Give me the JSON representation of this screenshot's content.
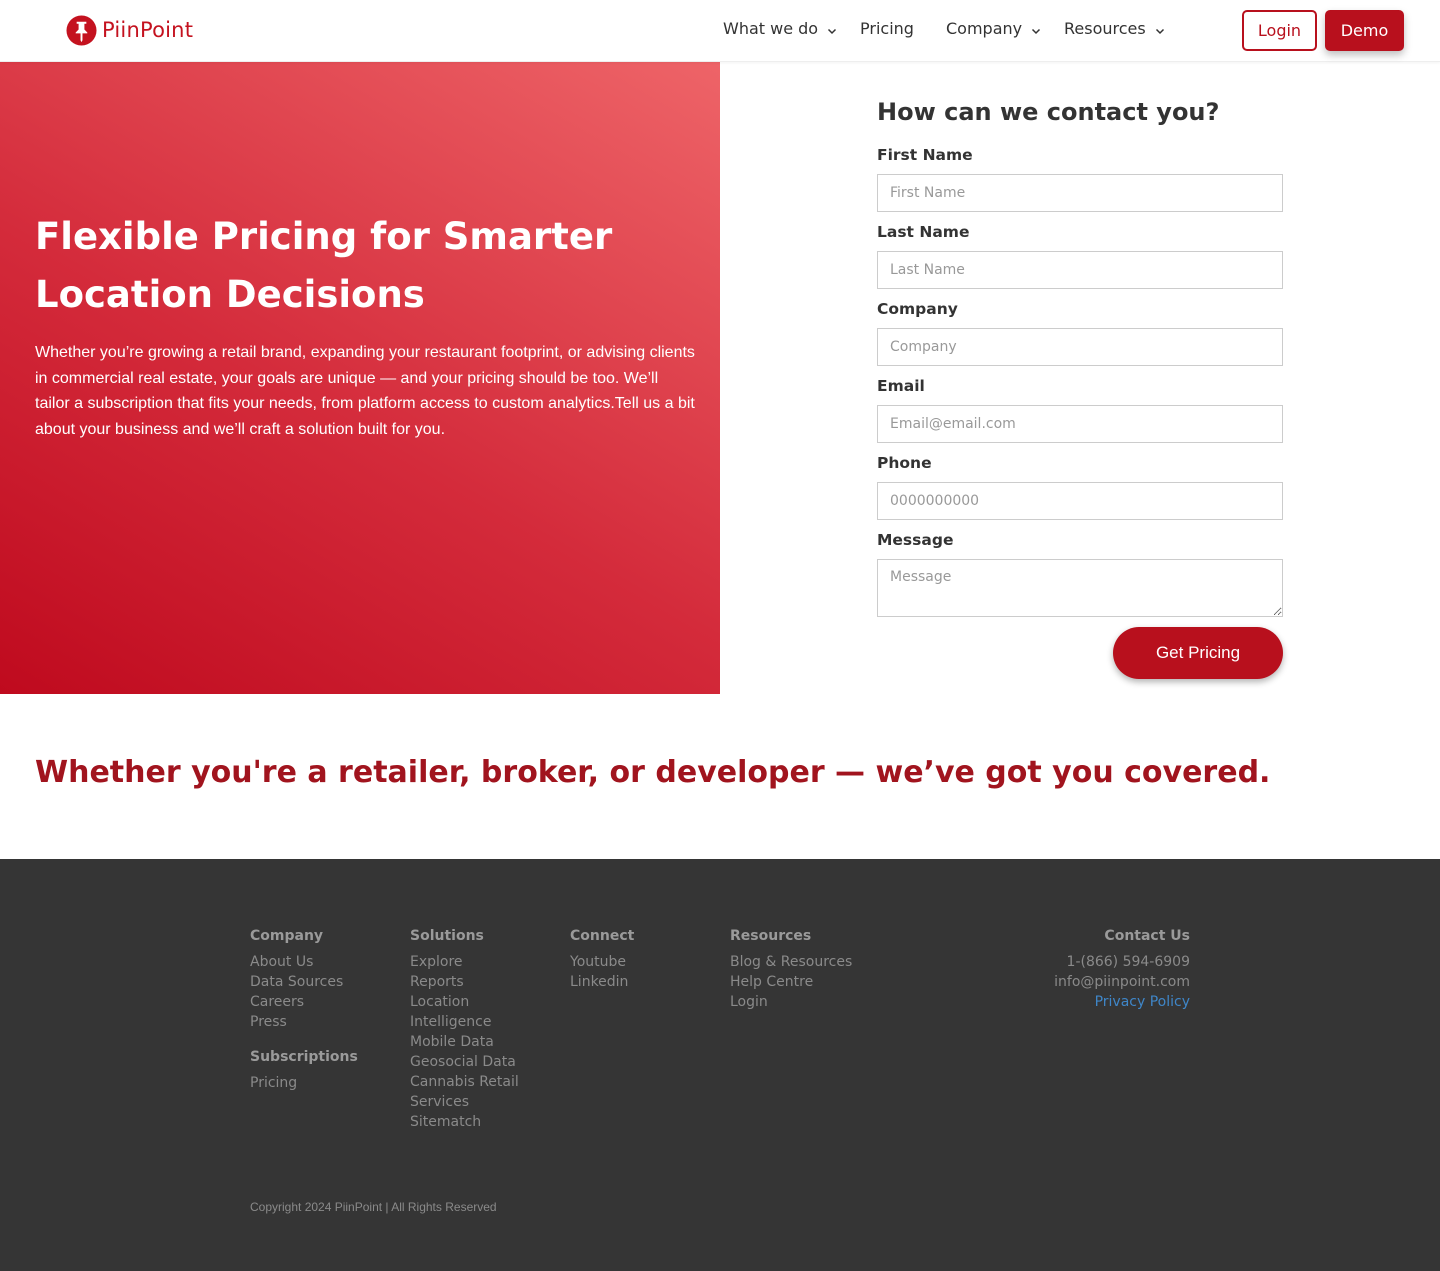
{
  "brand": {
    "name": "PiinPoint",
    "accent": "#b8101d"
  },
  "nav": {
    "items": [
      {
        "label": "What we do",
        "dropdown": true
      },
      {
        "label": "Pricing",
        "dropdown": false
      },
      {
        "label": "Company",
        "dropdown": true
      },
      {
        "label": "Resources",
        "dropdown": true
      }
    ],
    "login_label": "Login",
    "demo_label": "Demo"
  },
  "hero": {
    "title": "Flexible Pricing for Smarter Location Decisions",
    "text": "Whether you’re growing a retail brand, expanding your restaurant footprint, or advising clients in commercial real estate, your goals are unique — and your pricing should be too. We’ll tailor a subscription that fits your needs, from platform access to custom analytics.Tell us a bit about your business and we’ll craft a solution built for you."
  },
  "form": {
    "title": "How can we contact you?",
    "fields": [
      {
        "label": "First Name",
        "placeholder": "First Name"
      },
      {
        "label": "Last Name",
        "placeholder": "Last Name"
      },
      {
        "label": "Company",
        "placeholder": "Company"
      },
      {
        "label": "Email",
        "placeholder": "Email@email.com"
      },
      {
        "label": "Phone",
        "placeholder": "0000000000"
      },
      {
        "label": "Message",
        "placeholder": "Message"
      }
    ],
    "submit_label": "Get Pricing"
  },
  "tagline": "Whether you're a retailer, broker, or developer — we’ve got you covered.",
  "footer": {
    "company": {
      "heading": "Company",
      "links": [
        "About Us",
        "Data Sources",
        "Careers",
        "Press"
      ]
    },
    "subscriptions": {
      "heading": "Subscriptions",
      "links": [
        "Pricing"
      ]
    },
    "solutions": {
      "heading": "Solutions",
      "links": [
        "Explore",
        "Reports",
        "Location",
        "Intelligence",
        "Mobile Data",
        "Geosocial Data",
        "Cannabis Retail",
        "Services",
        "Sitematch"
      ]
    },
    "connect": {
      "heading": "Connect",
      "links": [
        "Youtube",
        "Linkedin"
      ]
    },
    "resources": {
      "heading": "Resources",
      "links": [
        "Blog & Resources",
        "Help Centre",
        "Login"
      ]
    },
    "contact": {
      "heading": "Contact Us",
      "phone": "1-(866) 594-6909",
      "email": "info@piinpoint.com",
      "privacy": "Privacy Policy"
    },
    "copyright": "Copyright 2024 PiinPoint | All Rights Reserved"
  }
}
